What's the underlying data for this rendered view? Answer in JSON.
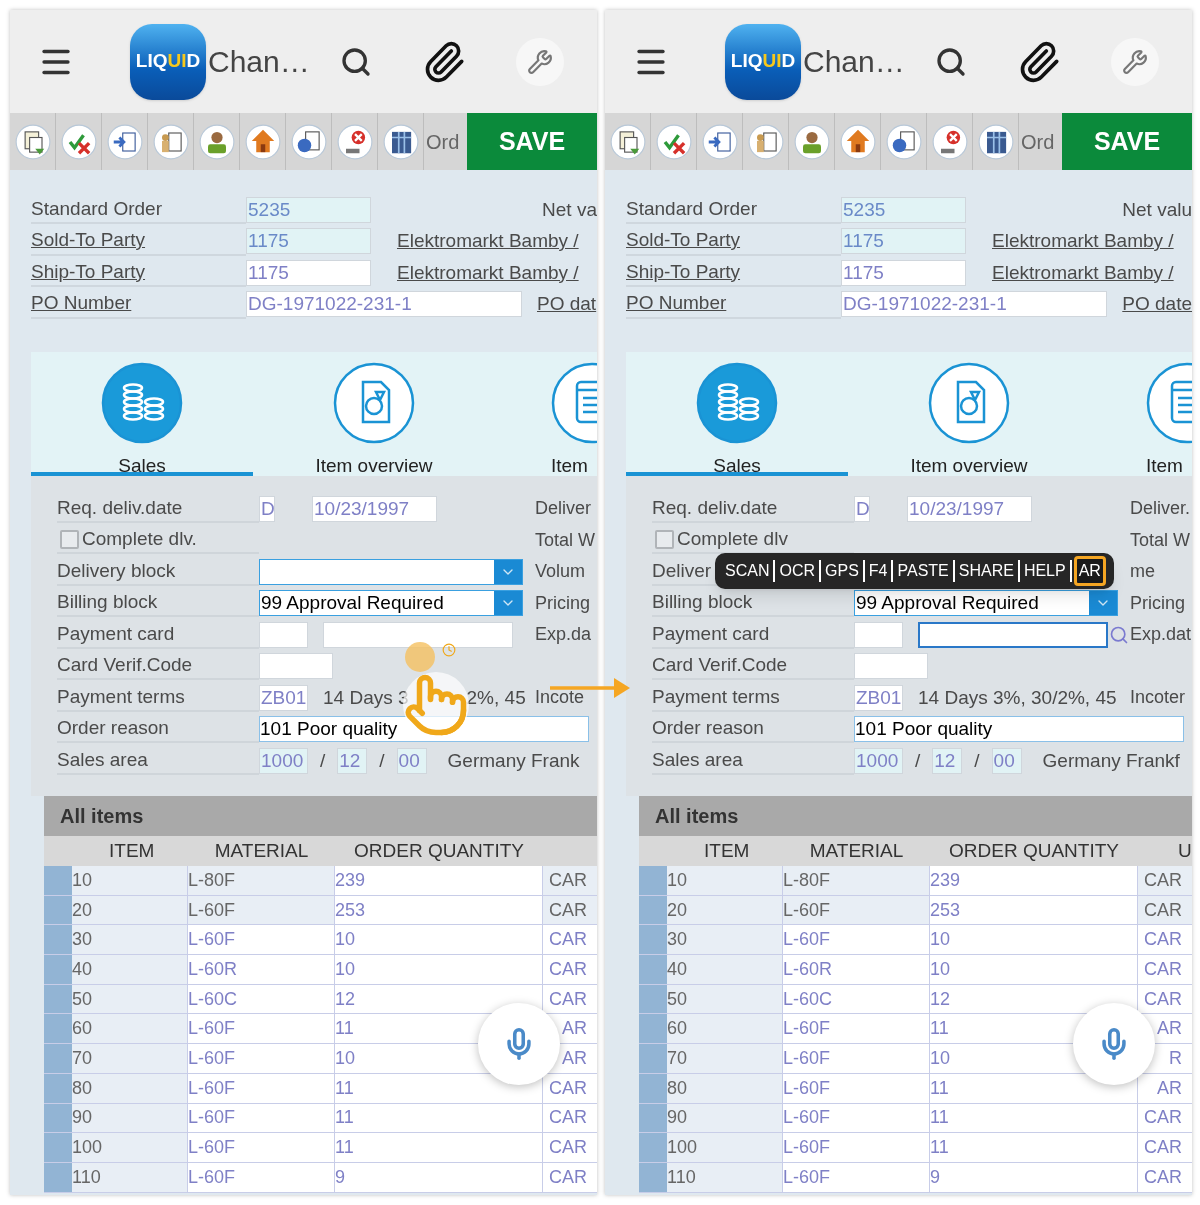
{
  "screens": [
    {
      "title": "Chan…",
      "logo": {
        "start": "LIQ",
        "highlight": "UI",
        "end": "D"
      },
      "toolbar": {
        "label": "Ord",
        "save": "SAVE"
      },
      "header_fields": [
        {
          "label": "Standard Order",
          "link": false,
          "value": "5235",
          "readonly": true,
          "wide": false,
          "right": "Net va",
          "right_link": false
        },
        {
          "label": "Sold-To Party",
          "link": true,
          "value": "1175",
          "readonly": true,
          "wide": false,
          "right": "Elektromarkt Bamby /",
          "right_link": true
        },
        {
          "label": "Ship-To Party",
          "link": true,
          "value": "1175",
          "readonly": false,
          "wide": false,
          "right": "Elektromarkt Bamby /",
          "right_link": true
        },
        {
          "label": "PO Number",
          "link": true,
          "value": "DG-1971022-231-1",
          "readonly": false,
          "wide": true,
          "right": "PO dat",
          "right_link": true
        }
      ],
      "tabs": [
        {
          "label": "Sales",
          "selected": true
        },
        {
          "label": "Item overview",
          "selected": false
        },
        {
          "label": "Item",
          "selected": false
        }
      ],
      "details": [
        {
          "kind": "date",
          "label": "Req. deliv.date",
          "code": "D",
          "value": "10/23/1997",
          "right": "Deliver"
        },
        {
          "kind": "checkbox",
          "label": "Complete dlv.",
          "checked": false,
          "right": "Total W"
        },
        {
          "kind": "dropdown",
          "label": "Delivery block",
          "right": "Volum"
        },
        {
          "kind": "dropdown",
          "label": "Billing block",
          "value": "99  Approval Required",
          "right": "Pricing"
        },
        {
          "kind": "card",
          "label": "Payment card",
          "focused": false,
          "right": "Exp.da"
        },
        {
          "kind": "short",
          "label": "Card Verif.Code"
        },
        {
          "kind": "terms",
          "label": "Payment terms",
          "code": "ZB01",
          "text_parts": [
            "14 Days 3",
            "2%, 45"
          ],
          "right": "Incote"
        },
        {
          "kind": "text",
          "label": "Order reason",
          "value": "101 Poor quality"
        },
        {
          "kind": "area",
          "label": "Sales area",
          "parts": [
            "1000",
            "/",
            "12",
            "/",
            "00"
          ],
          "text": "Germany Frank"
        }
      ],
      "tap_indicator": true,
      "items": {
        "title": "All items",
        "columns": [
          "ITEM",
          "MATERIAL",
          "ORDER QUANTITY"
        ],
        "rows": [
          {
            "item": "10",
            "material": "L-80F",
            "quantity": "239",
            "unit": "CAR",
            "editable": false
          },
          {
            "item": "20",
            "material": "L-60F",
            "quantity": "253",
            "unit": "CAR",
            "editable": false
          },
          {
            "item": "30",
            "material": "L-60F",
            "quantity": "10",
            "unit": "CAR",
            "editable": true
          },
          {
            "item": "40",
            "material": "L-60R",
            "quantity": "10",
            "unit": "CAR",
            "editable": true
          },
          {
            "item": "50",
            "material": "L-60C",
            "quantity": "12",
            "unit": "CAR",
            "editable": true
          },
          {
            "item": "60",
            "material": "L-60F",
            "quantity": "11",
            "unit": "AR",
            "editable": true
          },
          {
            "item": "70",
            "material": "L-60F",
            "quantity": "10",
            "unit": "AR",
            "editable": true
          },
          {
            "item": "80",
            "material": "L-60F",
            "quantity": "11",
            "unit": "CAR",
            "editable": true
          },
          {
            "item": "90",
            "material": "L-60F",
            "quantity": "11",
            "unit": "CAR",
            "editable": true
          },
          {
            "item": "100",
            "material": "L-60F",
            "quantity": "11",
            "unit": "CAR",
            "editable": true
          },
          {
            "item": "110",
            "material": "L-60F",
            "quantity": "9",
            "unit": "CAR",
            "editable": true
          }
        ]
      },
      "voice_button": true
    },
    {
      "title": "Chan…",
      "logo": {
        "start": "LIQ",
        "highlight": "UI",
        "end": "D"
      },
      "toolbar": {
        "label": "Ord",
        "save": "SAVE"
      },
      "header_fields": [
        {
          "label": "Standard Order",
          "link": false,
          "value": "5235",
          "readonly": true,
          "wide": false,
          "right": "Net valu",
          "right_link": false
        },
        {
          "label": "Sold-To Party",
          "link": true,
          "value": "1175",
          "readonly": true,
          "wide": false,
          "right": "Elektromarkt Bamby /",
          "right_link": true
        },
        {
          "label": "Ship-To Party",
          "link": true,
          "value": "1175",
          "readonly": false,
          "wide": false,
          "right": "Elektromarkt Bamby /",
          "right_link": true
        },
        {
          "label": "PO Number",
          "link": true,
          "value": "DG-1971022-231-1",
          "readonly": false,
          "wide": true,
          "right": "PO date",
          "right_link": true
        }
      ],
      "tabs": [
        {
          "label": "Sales",
          "selected": true
        },
        {
          "label": "Item overview",
          "selected": false
        },
        {
          "label": "Item",
          "selected": false
        }
      ],
      "details": [
        {
          "kind": "date",
          "label": "Req. deliv.date",
          "code": "D",
          "value": "10/23/1997",
          "right": "Deliver."
        },
        {
          "kind": "checkbox",
          "label": "Complete dlv",
          "checked": false,
          "right": "Total W"
        },
        {
          "kind": "plain",
          "label": "Deliver",
          "right": "me"
        },
        {
          "kind": "dropdown",
          "label": "Billing block",
          "value": "99  Approval Required",
          "right": "Pricing"
        },
        {
          "kind": "card",
          "label": "Payment card",
          "focused": true,
          "right": "Exp.dat"
        },
        {
          "kind": "short",
          "label": "Card Verif.Code"
        },
        {
          "kind": "terms",
          "label": "Payment terms",
          "code": "ZB01",
          "text_parts": [
            "14 Days 3%, 30/2%, 45"
          ],
          "right": "Incoter"
        },
        {
          "kind": "text",
          "label": "Order reason",
          "value": "101 Poor quality"
        },
        {
          "kind": "area",
          "label": "Sales area",
          "parts": [
            "1000",
            "/",
            "12",
            "/",
            "00"
          ],
          "text": "Germany Frankf"
        }
      ],
      "context_menu": [
        {
          "label": "SCAN",
          "selected": false
        },
        {
          "label": "OCR",
          "selected": false
        },
        {
          "label": "GPS",
          "selected": false
        },
        {
          "label": "F4",
          "selected": false
        },
        {
          "label": "PASTE",
          "selected": false
        },
        {
          "label": "SHARE",
          "selected": false
        },
        {
          "label": "HELP",
          "selected": false
        },
        {
          "label": "AR",
          "selected": true
        }
      ],
      "items": {
        "title": "All items",
        "columns": [
          "ITEM",
          "MATERIAL",
          "ORDER QUANTITY",
          "U"
        ],
        "rows": [
          {
            "item": "10",
            "material": "L-80F",
            "quantity": "239",
            "unit": "CAR",
            "editable": false
          },
          {
            "item": "20",
            "material": "L-60F",
            "quantity": "253",
            "unit": "CAR",
            "editable": false
          },
          {
            "item": "30",
            "material": "L-60F",
            "quantity": "10",
            "unit": "CAR",
            "editable": true
          },
          {
            "item": "40",
            "material": "L-60R",
            "quantity": "10",
            "unit": "CAR",
            "editable": true
          },
          {
            "item": "50",
            "material": "L-60C",
            "quantity": "12",
            "unit": "CAR",
            "editable": true
          },
          {
            "item": "60",
            "material": "L-60F",
            "quantity": "11",
            "unit": "AR",
            "editable": true
          },
          {
            "item": "70",
            "material": "L-60F",
            "quantity": "10",
            "unit": "R",
            "editable": true
          },
          {
            "item": "80",
            "material": "L-60F",
            "quantity": "11",
            "unit": "AR",
            "editable": true
          },
          {
            "item": "90",
            "material": "L-60F",
            "quantity": "11",
            "unit": "CAR",
            "editable": true
          },
          {
            "item": "100",
            "material": "L-60F",
            "quantity": "11",
            "unit": "CAR",
            "editable": true
          },
          {
            "item": "110",
            "material": "L-60F",
            "quantity": "9",
            "unit": "CAR",
            "editable": true
          }
        ]
      },
      "voice_button": true
    }
  ]
}
